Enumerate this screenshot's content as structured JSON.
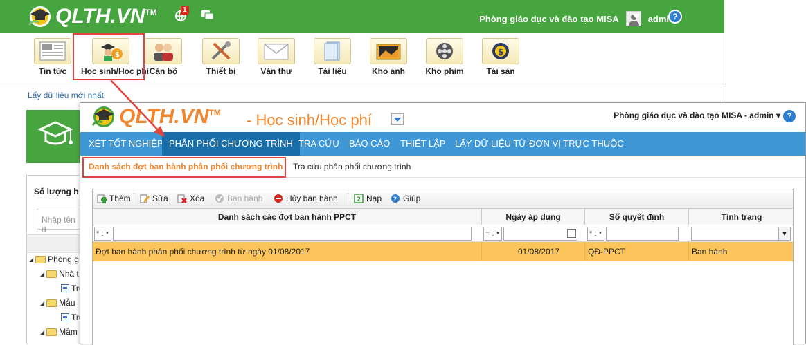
{
  "main": {
    "brand": "QLTH.VN",
    "tm": "TM",
    "notification_count": "1",
    "org": "Phòng giáo dục và đào tạo MISA",
    "user": "admin",
    "help": "?",
    "apps": [
      {
        "label": "Tin tức",
        "icon": "news-icon"
      },
      {
        "label": "Học sinh/Học phí",
        "icon": "student-fee-icon"
      },
      {
        "label": "Cán bộ",
        "icon": "staff-icon"
      },
      {
        "label": "Thiết bị",
        "icon": "equipment-icon"
      },
      {
        "label": "Văn thư",
        "icon": "mail-icon"
      },
      {
        "label": "Tài liệu",
        "icon": "document-icon"
      },
      {
        "label": "Kho ảnh",
        "icon": "photo-icon"
      },
      {
        "label": "Kho phim",
        "icon": "film-icon"
      },
      {
        "label": "Tài sản",
        "icon": "asset-icon"
      }
    ],
    "refresh_link": "Lấy dữ liệu mới nhất",
    "left_panel": {
      "header": "Số lượng h",
      "search_placeholder": "Nhập tên đ",
      "tree": [
        "Phòng g",
        "Nhà t",
        "Tru",
        "Mẫu",
        "Tru",
        "Mầm"
      ]
    }
  },
  "module": {
    "brand": "QLTH.VN",
    "tm": "TM",
    "title": "- Học sinh/Học phí",
    "account": "Phòng giáo dục và đào tạo MISA - admin ▾",
    "help": "?",
    "nav": [
      "XÉT TỐT NGHIỆP",
      "PHÂN PHỐI CHƯƠNG TRÌNH",
      "TRA CỨU",
      "BÁO CÁO",
      "THIẾT LẬP",
      "LẤY DỮ LIỆU TỪ ĐƠN VỊ TRỰC THUỘC"
    ],
    "subnav": [
      "Danh sách đợt ban hành phân phối chương trình",
      "Tra cứu phân phối chương trình"
    ],
    "toolbar": [
      {
        "label": "Thêm",
        "icon": "add-icon",
        "enabled": true
      },
      {
        "label": "Sửa",
        "icon": "edit-icon",
        "enabled": true
      },
      {
        "label": "Xóa",
        "icon": "delete-icon",
        "enabled": true
      },
      {
        "label": "Ban hành",
        "icon": "publish-icon",
        "enabled": false
      },
      {
        "label": "Hủy ban hành",
        "icon": "cancel-publish-icon",
        "enabled": true
      },
      {
        "label": "Nạp",
        "icon": "reload-icon",
        "enabled": true
      },
      {
        "label": "Giúp",
        "icon": "help-icon",
        "enabled": true
      }
    ],
    "grid": {
      "columns": [
        "Danh sách các đợt ban hành PPCT",
        "Ngày áp dụng",
        "Số quyết định",
        "Tình trạng"
      ],
      "filter_ops": [
        "* :",
        "= :",
        "* :"
      ],
      "rows": [
        {
          "name": "Đợt ban hành phân phối chương trình từ ngày 01/08/2017",
          "date": "01/08/2017",
          "decision": "QĐ-PPCT",
          "status": "Ban hành"
        }
      ]
    }
  },
  "colors": {
    "green": "#46a53f",
    "blue_nav": "#4097d6",
    "active_nav": "#1a6ea8",
    "orange": "#f0862e",
    "selected_row": "#fbc55c",
    "highlight": "#e0463b"
  }
}
